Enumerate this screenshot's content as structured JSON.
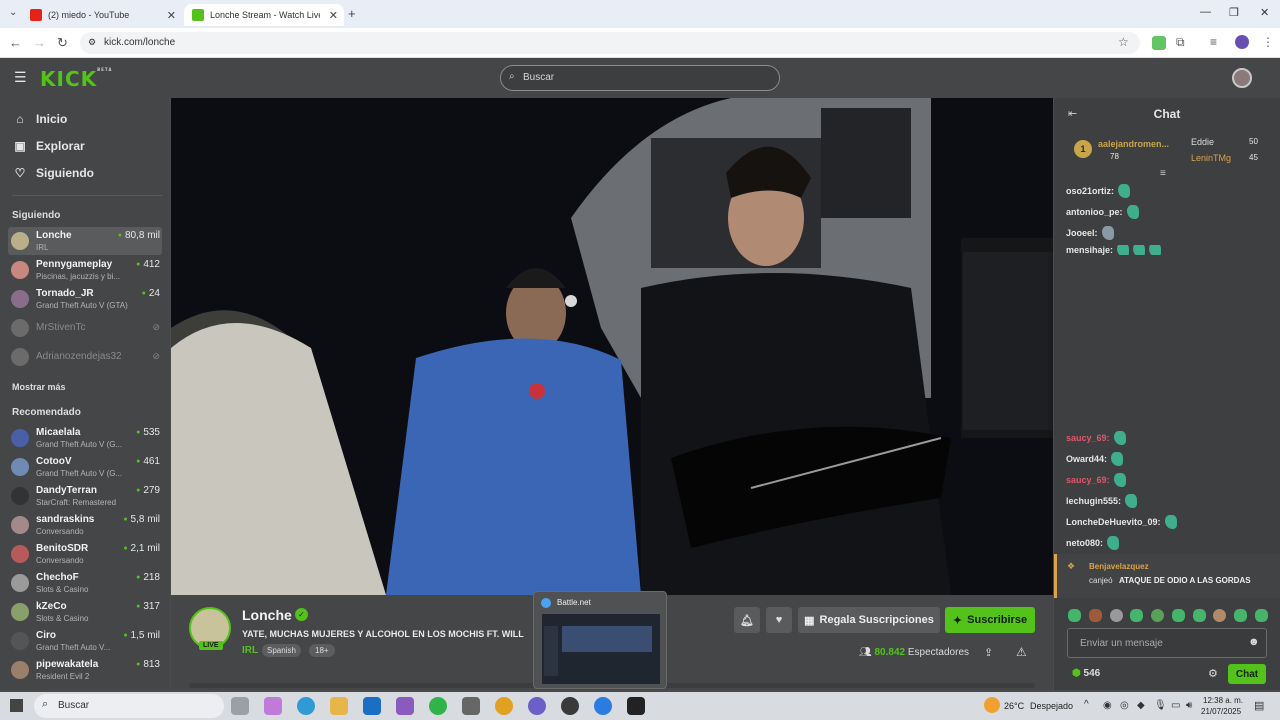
{
  "browser": {
    "tabs": [
      {
        "title": "(2) miedo - YouTube"
      },
      {
        "title": "Lonche Stream - Watch Live"
      }
    ],
    "url": "kick.com/lonche"
  },
  "topnav": {
    "logo": "KICK",
    "logo_badge": "BETA",
    "search_placeholder": "Buscar"
  },
  "sidebar": {
    "nav": [
      {
        "label": "Inicio",
        "icon": "home-icon"
      },
      {
        "label": "Explorar",
        "icon": "explore-icon"
      },
      {
        "label": "Siguiendo",
        "icon": "heart-icon"
      }
    ],
    "following_title": "Siguiendo",
    "following": [
      {
        "name": "Lonche",
        "game": "IRL",
        "viewers": "80,8 mil"
      },
      {
        "name": "Pennygameplay",
        "game": "Piscinas, jacuzzis y bi...",
        "viewers": "412"
      },
      {
        "name": "Tornado_JR",
        "game": "Grand Theft Auto V (GTA)",
        "viewers": "24"
      },
      {
        "name": "MrStivenTc",
        "game": "",
        "viewers": ""
      },
      {
        "name": "Adrianozendejas32",
        "game": "",
        "viewers": ""
      }
    ],
    "show_more": "Mostrar más",
    "recommended_title": "Recomendado",
    "recommended": [
      {
        "name": "Micaelala",
        "game": "Grand Theft Auto V (G...",
        "viewers": "535"
      },
      {
        "name": "CotooV",
        "game": "Grand Theft Auto V (G...",
        "viewers": "461"
      },
      {
        "name": "DandyTerran",
        "game": "StarCraft: Remastered",
        "viewers": "279"
      },
      {
        "name": "sandraskins",
        "game": "Conversando",
        "viewers": "5,8 mil"
      },
      {
        "name": "BenitoSDR",
        "game": "Conversando",
        "viewers": "2,1 mil"
      },
      {
        "name": "ChechoF",
        "game": "Slots & Casino",
        "viewers": "218"
      },
      {
        "name": "kZeCo",
        "game": "Slots & Casino",
        "viewers": "317"
      },
      {
        "name": "Ciro",
        "game": "Grand Theft Auto V...",
        "viewers": "1,5 mil"
      },
      {
        "name": "pipewakatela",
        "game": "Resident Evil 2",
        "viewers": "813"
      }
    ]
  },
  "stream": {
    "channel": "Lonche",
    "live_badge": "LIVE",
    "title": "YATE, MUCHAS MUJERES Y ALCOHOL EN LOS MOCHIS FT. WILL",
    "category": "IRL",
    "tags": [
      "Spanish",
      "18+"
    ],
    "gift_label": "Regala Suscripciones",
    "subscribe_label": "Suscribirse",
    "viewers": "80.842",
    "viewers_label": "Espectadores"
  },
  "popup": {
    "title": "Battle.net"
  },
  "chat": {
    "title": "Chat",
    "leaders": [
      {
        "rank": "1",
        "name": "aalejandromen...",
        "count": "78"
      },
      {
        "name": "Eddie",
        "count": "50"
      },
      {
        "name": "LeninTMg",
        "count": "45"
      }
    ],
    "messages": [
      {
        "user": "oso21ortiz:",
        "color": "#ffffff"
      },
      {
        "user": "antonioo_pe:",
        "color": "#ffffff"
      },
      {
        "user": "Jooeel:",
        "color": "#ffffff"
      },
      {
        "user": "mensihaje:",
        "color": "#ffffff"
      },
      {
        "user": "saucy_69:",
        "color": "#e0566a"
      },
      {
        "user": "Oward44:",
        "color": "#ffffff"
      },
      {
        "user": "saucy_69:",
        "color": "#e0566a"
      },
      {
        "user": "lechugin555:",
        "color": "#ffffff"
      },
      {
        "user": "LoncheDeHuevito_09:",
        "color": "#ffffff"
      },
      {
        "user": "neto080:",
        "color": "#ffffff"
      }
    ],
    "gift_user": "Benjavelazquez",
    "gift_action": "canjeó",
    "gift_reward": "ATAQUE DE ODIO A LAS GORDAS",
    "input_placeholder": "Enviar un mensaje",
    "points": "546",
    "send_label": "Chat"
  },
  "taskbar": {
    "search": "Buscar",
    "weather_temp": "26°C",
    "weather_desc": "Despejado",
    "time": "12:38 a. m.",
    "date": "21/07/2025"
  }
}
